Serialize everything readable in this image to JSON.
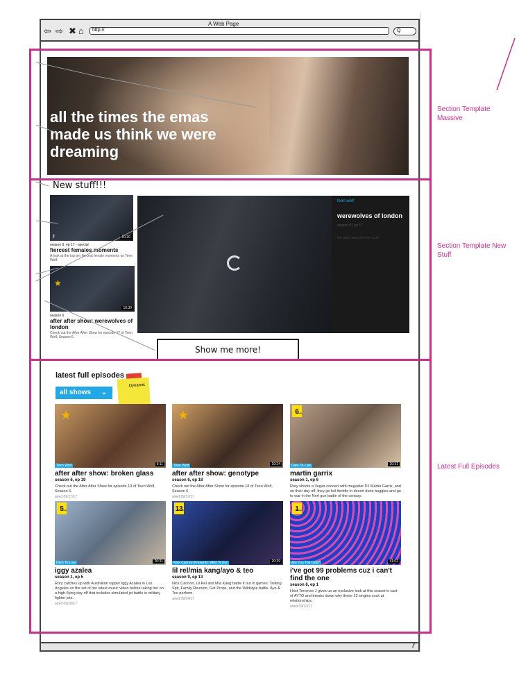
{
  "browser": {
    "window_title": "A Web Page",
    "url": "http://",
    "search_placeholder": "Q"
  },
  "hero": {
    "title": "all the times the emas made us think we were dreaming"
  },
  "new_stuff": {
    "heading": "New stuff!!!",
    "items": [
      {
        "meta": "season 6, ep 17 - special",
        "title": "fiercest females moments",
        "desc": "A look at the top ten fiercest female moments on Teen Wolf.",
        "duration": "10:30"
      },
      {
        "meta": "season 6",
        "title": "after after show: werewolves of london",
        "desc": "Check out the After After Show for episode 17 of Teen Wolf, Season 6.",
        "duration": "10:30"
      }
    ],
    "featured": {
      "show": "teen wolf",
      "title": "werewolves of london",
      "meta": "season 6 | ep 17",
      "desc": "the pack searches for scott"
    },
    "show_more_label": "Show me more!"
  },
  "latest": {
    "heading": "latest full episodes",
    "filter_label": "all shows",
    "sticky_note": "Dynamic",
    "episodes": [
      {
        "badge": "Teen Wolf",
        "duration": "9:11",
        "rank_label": "",
        "rank": "",
        "title": "after after show: broken glass",
        "season": "season 6, ep 19",
        "desc": "Check out the After After Show for episode 19 of Teen Wolf, Season 6.",
        "aired": "aired 09/17/17"
      },
      {
        "badge": "Teen Wolf",
        "duration": "10:24",
        "rank_label": "",
        "rank": "",
        "title": "after after show: genotype",
        "season": "season 6, ep 18",
        "desc": "Check out the After After Show for episode 18 of Teen Wolf, Season 6.",
        "aired": "aired 09/17/17"
      },
      {
        "badge": "Dare To Live",
        "duration": "20:31",
        "rank_label": "full ep",
        "rank": "6",
        "title": "martin garrix",
        "season": "season 1, ep 6",
        "desc": "Rory shoots a Vegas concert with megastar DJ Martin Garrix, and on their day off, they go full throttle in desert dune buggies and go to war in the Nerf gun battle of the century.",
        "aired": "aired 09/16/17"
      },
      {
        "badge": "Dare To Live",
        "duration": "20:31",
        "rank_label": "full ep",
        "rank": "5",
        "title": "iggy azalea",
        "season": "season 1, ep 5",
        "desc": "Rory catches up with Australian rapper Iggy Azalea in Los Angeles on the set of her latest music video before taking her on a high-flying day off that includes simulated jet battle in military fighter jets.",
        "aired": "aired 09/16/17"
      },
      {
        "badge": "Nick Cannon Presents: Wild 'N Out",
        "duration": "20:29",
        "rank_label": "full ep",
        "rank": "13",
        "title": "lil rel/mia kang/ayo & teo",
        "season": "season 9, ep 13",
        "desc": "Nick Cannon, Lil Rel and Mia Kang battle it out in games: Talking Spit, Family Reunion, Got Props, and the Wildstyle battle. Ayo & Teo perform.",
        "aired": "aired 09/14/17"
      },
      {
        "badge": "Are You The One?",
        "duration": "41:02",
        "rank_label": "full ep",
        "rank": "1",
        "title": "i've got 99 problems cuz i can't find the one",
        "season": "season 6, ep 1",
        "desc": "Host Terrence J gives us an exclusive look at this season's cast of AYTO and breaks down why these 22 singles suck at relationships.",
        "aired": "aired 09/13/17"
      }
    ]
  },
  "annotations": {
    "massive": "Section Template Massive",
    "newstuff": "Section Template New Stuff",
    "latest": "Latest Full Episodes"
  },
  "colors": {
    "annotation": "#d42c8c",
    "accent": "#1fa9e8",
    "rank": "#ffe000"
  }
}
